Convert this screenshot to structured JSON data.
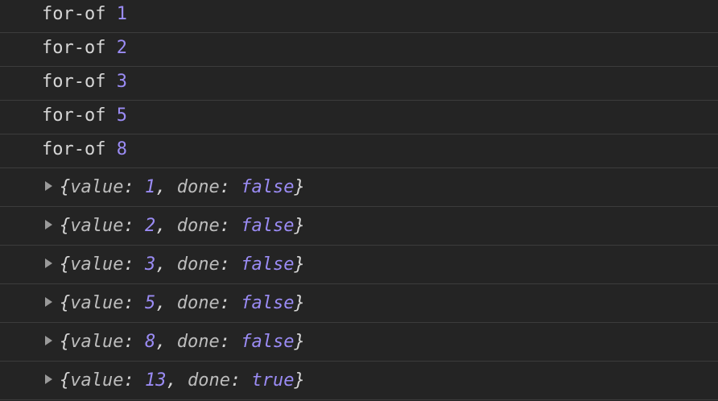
{
  "log_lines": [
    {
      "label": "for-of",
      "value": "1"
    },
    {
      "label": "for-of",
      "value": "2"
    },
    {
      "label": "for-of",
      "value": "3"
    },
    {
      "label": "for-of",
      "value": "5"
    },
    {
      "label": "for-of",
      "value": "8"
    }
  ],
  "iterator_results": [
    {
      "value_key": "value",
      "value": "1",
      "done_key": "done",
      "done": "false"
    },
    {
      "value_key": "value",
      "value": "2",
      "done_key": "done",
      "done": "false"
    },
    {
      "value_key": "value",
      "value": "3",
      "done_key": "done",
      "done": "false"
    },
    {
      "value_key": "value",
      "value": "5",
      "done_key": "done",
      "done": "false"
    },
    {
      "value_key": "value",
      "value": "8",
      "done_key": "done",
      "done": "false"
    },
    {
      "value_key": "value",
      "value": "13",
      "done_key": "done",
      "done": "true"
    }
  ],
  "colors": {
    "background": "#242424",
    "text": "#d6d6d6",
    "number": "#9b8cf5",
    "divider": "#3c3c3c"
  },
  "icons": {
    "expand": "disclosure-triangle-right-icon"
  }
}
